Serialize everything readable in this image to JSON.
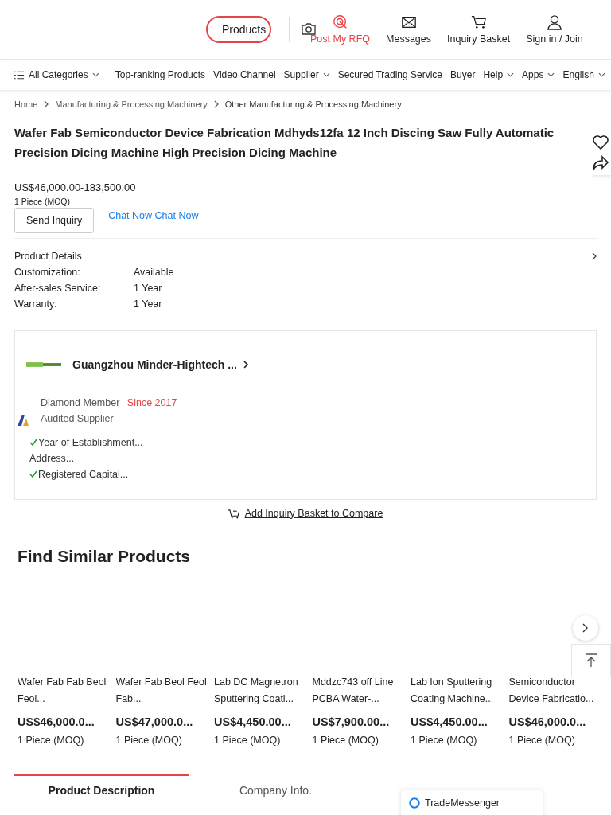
{
  "header": {
    "search_scope": "Products",
    "actions": [
      {
        "label": "Post My RFQ",
        "kind": "rfq"
      },
      {
        "label": "Messages",
        "kind": "mail"
      },
      {
        "label": "Inquiry Basket",
        "kind": "cart"
      },
      {
        "label": "Sign in / Join",
        "kind": "user"
      }
    ]
  },
  "nav": {
    "categories": "All Categories",
    "items": [
      {
        "label": "Top-ranking Products",
        "dropdown": false
      },
      {
        "label": "Video Channel",
        "dropdown": false
      },
      {
        "label": "Supplier",
        "dropdown": true
      },
      {
        "label": "Secured Trading Service",
        "dropdown": false
      },
      {
        "label": "Buyer",
        "dropdown": false
      },
      {
        "label": "Help",
        "dropdown": true
      },
      {
        "label": "Apps",
        "dropdown": true
      },
      {
        "label": "English",
        "dropdown": true
      }
    ]
  },
  "breadcrumb": [
    "Home",
    "Manufacturing & Processing Machinery",
    "Other Manufacturing & Processing Machinery"
  ],
  "product": {
    "title": "Wafer Fab Semiconductor Device Fabrication Mdhyds12fa 12 Inch Discing Saw Fully Automatic Precision Dicing Machine High Precision Dicing Machine",
    "price": "US$46,000.00-183,500.00",
    "moq": "1 Piece (MOQ)",
    "inquiry_button": "Send Inquiry",
    "chat_link": "Chat Now Chat Now"
  },
  "details": {
    "heading": "Product Details",
    "rows": [
      {
        "label": "Customization:",
        "value": "Available"
      },
      {
        "label": "After-sales Service:",
        "value": "1 Year"
      },
      {
        "label": "Warranty:",
        "value": "1 Year"
      }
    ]
  },
  "supplier": {
    "name": "Guangzhou Minder-Hightech ...",
    "membership": "Diamond Member",
    "since": "Since 2017",
    "audited": "Audited Supplier",
    "facts": [
      {
        "label": "Year of Establishment...",
        "verified": true
      },
      {
        "label": "Address...",
        "verified": false
      },
      {
        "label": "Registered Capital...",
        "verified": true
      }
    ]
  },
  "compare_link": "Add Inquiry Basket to Compare",
  "similar": {
    "heading": "Find Similar Products",
    "items": [
      {
        "name": "Wafer Fab Fab Beol Feol...",
        "price": "US$46,000.0...",
        "moq": "1 Piece (MOQ)"
      },
      {
        "name": "Wafer Fab Beol Feol Fab...",
        "price": "US$47,000.0...",
        "moq": "1 Piece (MOQ)"
      },
      {
        "name": "Lab DC Magnetron Sputtering Coati...",
        "price": "US$4,450.00...",
        "moq": "1 Piece (MOQ)"
      },
      {
        "name": "Mddzc743 off Line PCBA Water-...",
        "price": "US$7,900.00...",
        "moq": "1 Piece (MOQ)"
      },
      {
        "name": "Lab Ion Sputtering Coating Machine...",
        "price": "US$4,450.00...",
        "moq": "1 Piece (MOQ)"
      },
      {
        "name": "Semiconductor Device Fabricatio...",
        "price": "US$46,000.0...",
        "moq": "1 Piece (MOQ)"
      }
    ]
  },
  "tabs": [
    {
      "label": "Product Description",
      "selected": true
    },
    {
      "label": "Company Info.",
      "selected": false
    }
  ],
  "messenger": "TradeMessenger"
}
